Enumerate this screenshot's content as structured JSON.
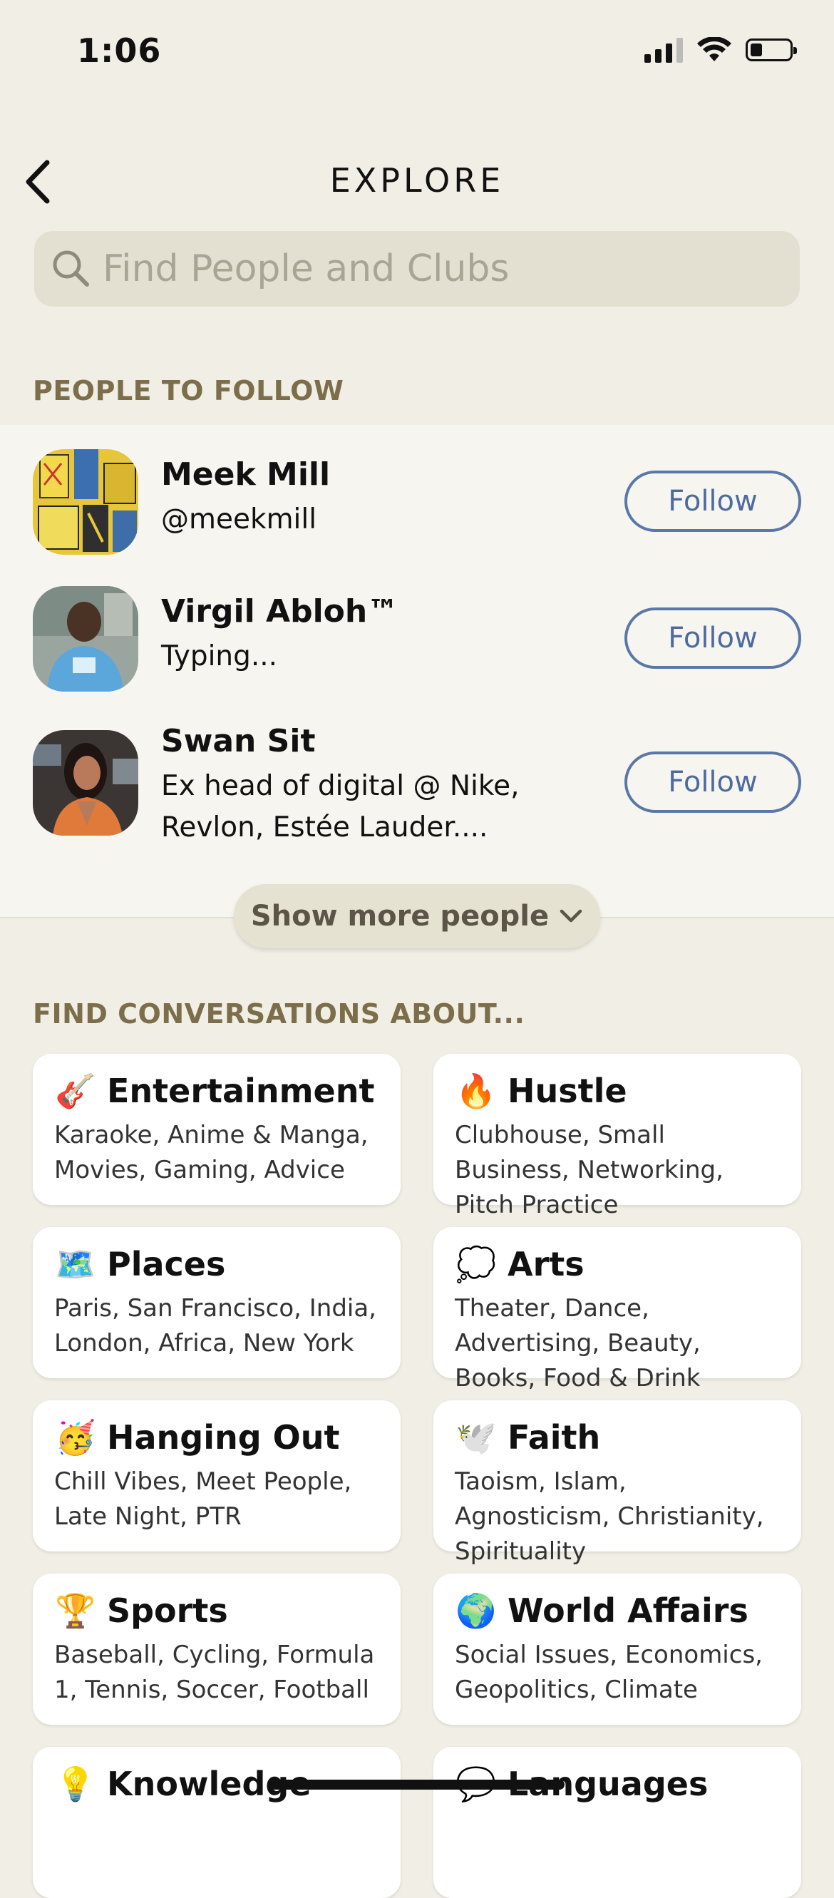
{
  "status_bar": {
    "time": "1:06"
  },
  "header": {
    "title": "EXPLORE"
  },
  "search": {
    "placeholder": "Find People and Clubs"
  },
  "people_section": {
    "label": "PEOPLE TO FOLLOW",
    "people": [
      {
        "name": "Meek Mill",
        "subtitle": "@meekmill",
        "button": "Follow"
      },
      {
        "name": "Virgil Abloh™",
        "subtitle": "Typing...",
        "button": "Follow"
      },
      {
        "name": "Swan Sit",
        "subtitle": "Ex head of digital @ Nike, Revlon, Estée Lauder....",
        "button": "Follow"
      }
    ],
    "show_more": "Show more people"
  },
  "conversations_section": {
    "label": "FIND CONVERSATIONS ABOUT...",
    "topics": [
      {
        "emoji": "🎸",
        "title": "Entertainment",
        "desc": "Karaoke, Anime & Manga, Movies, Gaming, Advice"
      },
      {
        "emoji": "🔥",
        "title": "Hustle",
        "desc": "Clubhouse, Small Business, Networking, Pitch Practice"
      },
      {
        "emoji": "🗺️",
        "title": "Places",
        "desc": "Paris, San Francisco, India, London, Africa, New York"
      },
      {
        "emoji": "💭",
        "title": "Arts",
        "desc": "Theater, Dance, Advertising, Beauty, Books, Food & Drink"
      },
      {
        "emoji": "🥳",
        "title": "Hanging Out",
        "desc": "Chill Vibes, Meet People, Late Night, PTR"
      },
      {
        "emoji": "🕊️",
        "title": "Faith",
        "desc": "Taoism, Islam, Agnosticism, Christianity, Spirituality"
      },
      {
        "emoji": "🏆",
        "title": "Sports",
        "desc": "Baseball, Cycling, Formula 1, Tennis, Soccer, Football"
      },
      {
        "emoji": "🌍",
        "title": "World Affairs",
        "desc": "Social Issues, Economics, Geopolitics, Climate"
      },
      {
        "emoji": "💡",
        "title": "Knowledge",
        "desc": ""
      },
      {
        "emoji": "💬",
        "title": "Languages",
        "desc": ""
      }
    ]
  },
  "colors": {
    "background": "#F1EFE5",
    "accent": "#5A77A8",
    "section_label": "#7C6E4A"
  }
}
